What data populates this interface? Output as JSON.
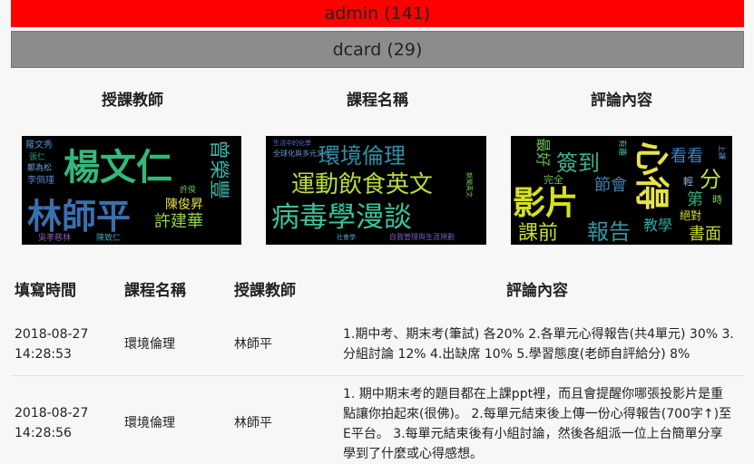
{
  "filters": {
    "admin_label": "admin (141)",
    "dcard_label": "dcard (29)"
  },
  "clouds": {
    "teacher_title": "授課教師",
    "course_title": "課程名稱",
    "comment_title": "評論內容",
    "teacher_words": [
      "楊文仁",
      "林師平",
      "許建華",
      "曾榮豐",
      "陳俊昇",
      "羅文秀",
      "李佩瑾",
      "鄭為松",
      "吳孝慈林",
      "陳致仁",
      "許俊",
      "張仁"
    ],
    "course_words": [
      "環境倫理",
      "運動飲食英文",
      "病毒學漫談",
      "全球化與多元文化",
      "生活中的化學",
      "自我管理與生涯規劃",
      "社會學",
      "新聞英文"
    ],
    "comment_words": [
      "影片",
      "心得",
      "報告",
      "簽到",
      "課前",
      "最好",
      "節會",
      "教學",
      "書面",
      "看看",
      "分",
      "第",
      "時",
      "輕",
      "絕對",
      "上課",
      "有趣",
      "完全"
    ]
  },
  "table": {
    "headers": {
      "time": "填寫時間",
      "course": "課程名稱",
      "teacher": "授課教師",
      "comment": "評論內容"
    },
    "rows": [
      {
        "date": "2018-08-27",
        "time": "14:28:53",
        "course": "環境倫理",
        "teacher": "林師平",
        "comment": "1.期中考、期末考(筆試) 各20% 2.各單元心得報告(共4單元) 30% 3.分組討論 12% 4.出缺席 10% 5.學習態度(老師自評給分) 8%"
      },
      {
        "date": "2018-08-27",
        "time": "14:28:56",
        "course": "環境倫理",
        "teacher": "林師平",
        "comment": "1. 期中期末考的題目都在上課ppt裡，而且會提醒你哪張投影片是重點讓你拍起來(很佛)。 2.每單元結束後上傳一份心得報告(700字↑)至E平台。 3.每單元結束後有小組討論，然後各組派一位上台簡單分享學到了什麼或心得感想。"
      }
    ]
  }
}
